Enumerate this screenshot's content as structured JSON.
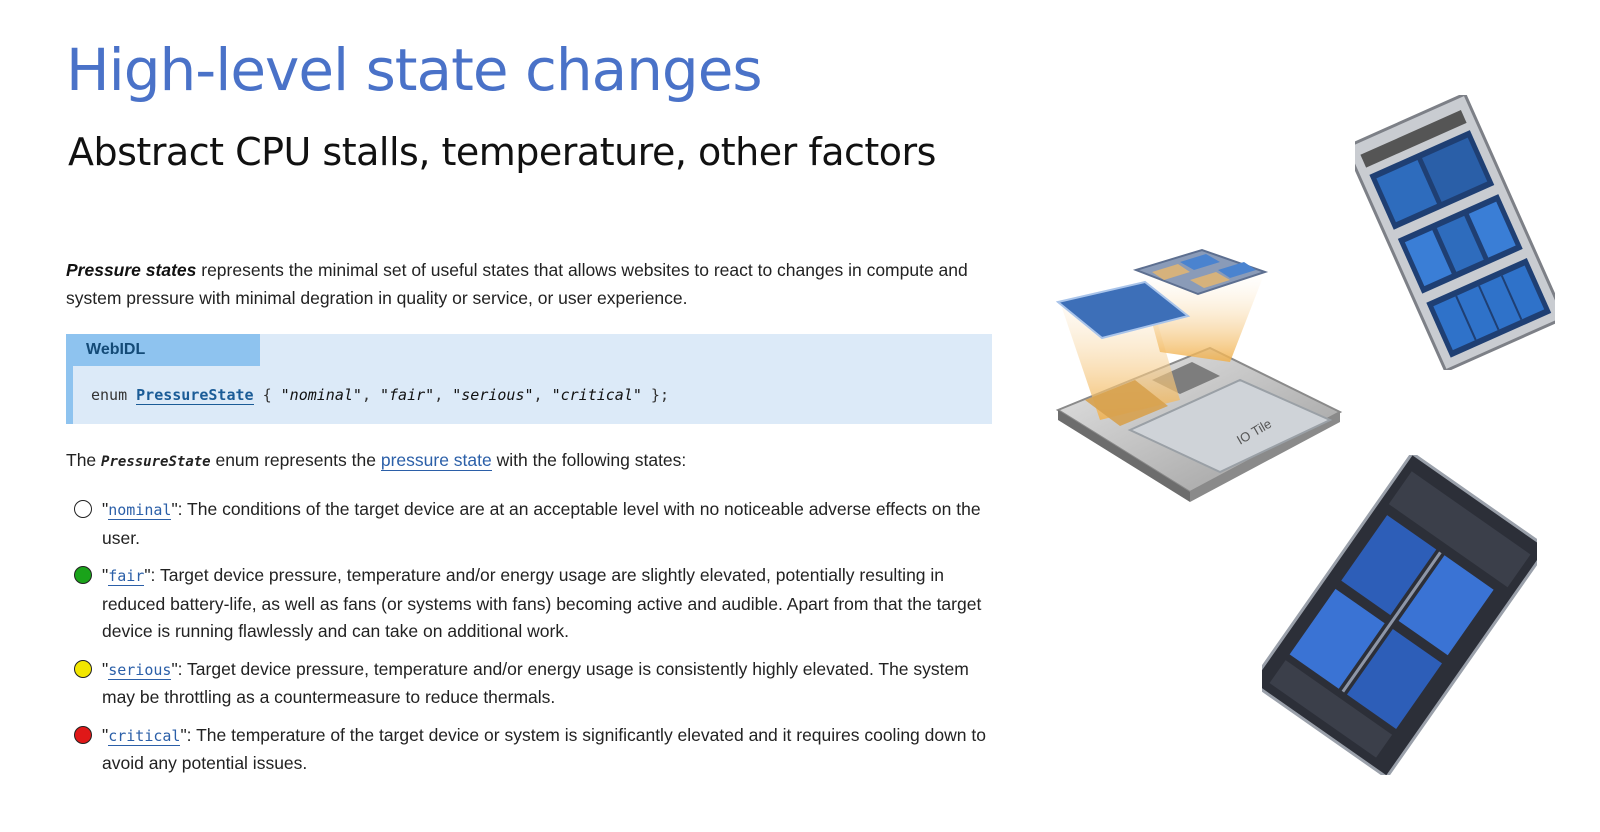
{
  "slide": {
    "title": "High-level state changes",
    "subtitle": "Abstract CPU stalls, temperature, other factors"
  },
  "intro": {
    "term": "Pressure states",
    "text": " represents the minimal set of useful states that allows websites to react to changes in compute and system pressure with minimal degration in quality or service, or user experience."
  },
  "webidl": {
    "label": "WebIDL",
    "keyword": "enum ",
    "type_name": "PressureState",
    "open": " { ",
    "values": [
      "\"nominal\"",
      "\"fair\"",
      "\"serious\"",
      "\"critical\""
    ],
    "sep": ", ",
    "close": " };"
  },
  "enum_line": {
    "prefix": "The ",
    "type_name": "PressureState",
    "middle": " enum represents the ",
    "link": "pressure state",
    "suffix": " with the following states:"
  },
  "states": [
    {
      "name": "nominal",
      "color": "#ffffff",
      "text": "\": The conditions of the target device are at an acceptable level with no noticeable adverse effects on the user."
    },
    {
      "name": "fair",
      "color": "#1aa31a",
      "text": "\": Target device pressure, temperature and/or energy usage are slightly elevated, potentially resulting in reduced battery-life, as well as fans (or systems with fans) becoming active and audible. Apart from that the target device is running flawlessly and can take on additional work."
    },
    {
      "name": "serious",
      "color": "#f2e600",
      "text": "\": Target device pressure, temperature and/or energy usage is consistently highly elevated. The system may be throttling as a countermeasure to reduce thermals."
    },
    {
      "name": "critical",
      "color": "#e01818",
      "text": "\": The temperature of the target device or system is significantly elevated and it requires cooling down to avoid any potential issues."
    }
  ],
  "images": {
    "chiplet_label": "IO Tile"
  }
}
